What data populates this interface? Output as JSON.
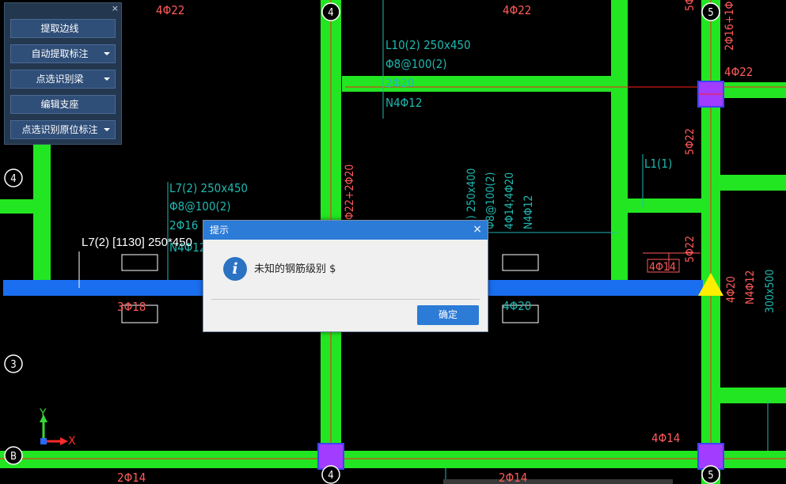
{
  "panel": {
    "close_glyph": "×",
    "buttons": [
      {
        "label": "提取边线",
        "dropdown": false
      },
      {
        "label": "自动提取标注",
        "dropdown": true
      },
      {
        "label": "点选识别梁",
        "dropdown": true
      },
      {
        "label": "编辑支座",
        "dropdown": false
      },
      {
        "label": "点选识别原位标注",
        "dropdown": true
      }
    ]
  },
  "dialog": {
    "title": "提示",
    "close_glyph": "×",
    "icon": "info-icon",
    "icon_glyph": "i",
    "message": "未知的钢筋级别 $",
    "ok_label": "确定"
  },
  "axes": {
    "x_label": "X",
    "y_label": "Y"
  },
  "canvas": {
    "colors": {
      "background": "#000000",
      "beam_green": "#22e622",
      "beam_selected": "#1a6ef0",
      "column_fill": "#a23cff",
      "column_border": "#4040ff",
      "axis_red": "#ff2020",
      "annot_cyan": "#1fb8b0",
      "annot_red": "#ff5a5a",
      "white_text": "#ffffff",
      "yellow_marker": "#ffee00"
    },
    "grid_bubbles": [
      "4",
      "5",
      "4",
      "3",
      "B",
      "4",
      "5"
    ],
    "texts": {
      "top_4phi22_a": "4Φ22",
      "top_4phi22_b": "4Φ22",
      "top_5phi": "5Φ",
      "right_2phi16": "2Φ16+1Φ",
      "right_4phi22": "4Φ22",
      "l10_title": "L10(2) 250x450",
      "l10_stirrup": "Φ8@100(2)",
      "l10_top": "2Φ20",
      "l10_side": "N4Φ12",
      "right_5phi22_a": "5Φ22",
      "l1_label": "L1(1)",
      "vert_22_2phi20": "Φ22+2Φ20",
      "mid_l1_title": "(1) 250x400",
      "mid_l1_stirrup": "Φ8@100(2)",
      "mid_l1_top": "4Φ14;4Φ20",
      "mid_l1_side": "N4Φ12",
      "l7_title": "L7(2) 250x450",
      "l7_stirrup": "Φ8@100(2)",
      "l7_top": "2Φ16",
      "l7_side": "N4Φ12",
      "selected_beam_label": "L7(2) [1130] 250*450",
      "right_5phi22_b": "5Φ22",
      "right_4phi14_box": "4Φ14",
      "right_4phi20": "4Φ20",
      "right_n4phi12": "N4Φ12",
      "right_300x500": "300x500",
      "bot_3phi18": "3Φ18",
      "bot_4phi20": "4Φ20",
      "bot_4phi14": "4Φ14",
      "bot_2phi14_a": "2Φ14",
      "bot_2phi14_b": "2Φ14"
    }
  }
}
